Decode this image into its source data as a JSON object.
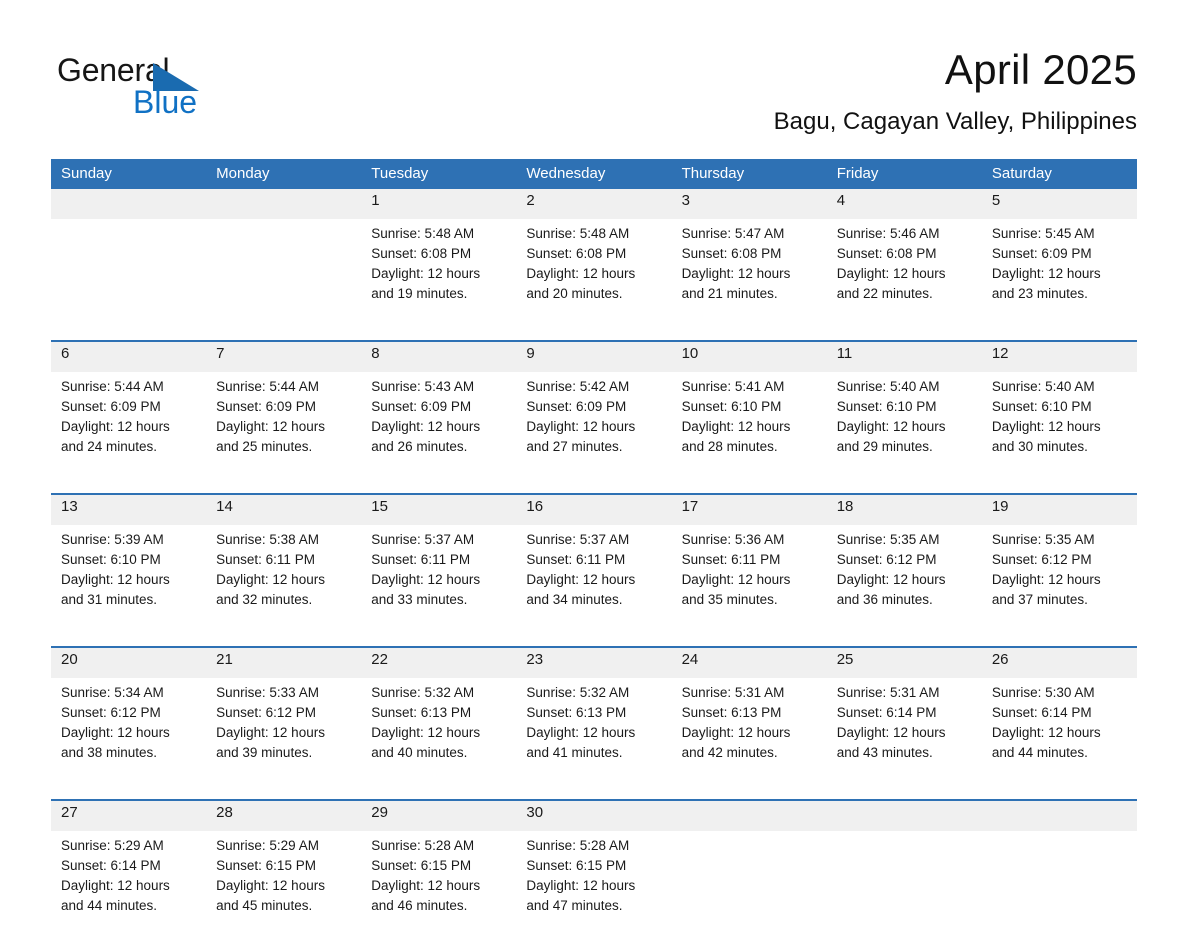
{
  "logo": {
    "word_one": "General",
    "word_two": "Blue",
    "triangle_color": "#1a6bb0",
    "blue_color": "#1071c4"
  },
  "header": {
    "title": "April 2025",
    "subtitle": "Bagu, Cagayan Valley, Philippines"
  },
  "theme": {
    "header_blue": "#2e71b4",
    "row_rule_blue": "#2e71b4",
    "daynum_band": "#f0f0f0",
    "page_background": "#ffffff",
    "text": "#1a1a1a"
  },
  "calendar": {
    "day_headers": [
      "Sunday",
      "Monday",
      "Tuesday",
      "Wednesday",
      "Thursday",
      "Friday",
      "Saturday"
    ],
    "weeks": [
      [
        {
          "day": "",
          "lines": []
        },
        {
          "day": "",
          "lines": []
        },
        {
          "day": "1",
          "lines": [
            "Sunrise: 5:48 AM",
            "Sunset: 6:08 PM",
            "Daylight: 12 hours",
            "and 19 minutes."
          ]
        },
        {
          "day": "2",
          "lines": [
            "Sunrise: 5:48 AM",
            "Sunset: 6:08 PM",
            "Daylight: 12 hours",
            "and 20 minutes."
          ]
        },
        {
          "day": "3",
          "lines": [
            "Sunrise: 5:47 AM",
            "Sunset: 6:08 PM",
            "Daylight: 12 hours",
            "and 21 minutes."
          ]
        },
        {
          "day": "4",
          "lines": [
            "Sunrise: 5:46 AM",
            "Sunset: 6:08 PM",
            "Daylight: 12 hours",
            "and 22 minutes."
          ]
        },
        {
          "day": "5",
          "lines": [
            "Sunrise: 5:45 AM",
            "Sunset: 6:09 PM",
            "Daylight: 12 hours",
            "and 23 minutes."
          ]
        }
      ],
      [
        {
          "day": "6",
          "lines": [
            "Sunrise: 5:44 AM",
            "Sunset: 6:09 PM",
            "Daylight: 12 hours",
            "and 24 minutes."
          ]
        },
        {
          "day": "7",
          "lines": [
            "Sunrise: 5:44 AM",
            "Sunset: 6:09 PM",
            "Daylight: 12 hours",
            "and 25 minutes."
          ]
        },
        {
          "day": "8",
          "lines": [
            "Sunrise: 5:43 AM",
            "Sunset: 6:09 PM",
            "Daylight: 12 hours",
            "and 26 minutes."
          ]
        },
        {
          "day": "9",
          "lines": [
            "Sunrise: 5:42 AM",
            "Sunset: 6:09 PM",
            "Daylight: 12 hours",
            "and 27 minutes."
          ]
        },
        {
          "day": "10",
          "lines": [
            "Sunrise: 5:41 AM",
            "Sunset: 6:10 PM",
            "Daylight: 12 hours",
            "and 28 minutes."
          ]
        },
        {
          "day": "11",
          "lines": [
            "Sunrise: 5:40 AM",
            "Sunset: 6:10 PM",
            "Daylight: 12 hours",
            "and 29 minutes."
          ]
        },
        {
          "day": "12",
          "lines": [
            "Sunrise: 5:40 AM",
            "Sunset: 6:10 PM",
            "Daylight: 12 hours",
            "and 30 minutes."
          ]
        }
      ],
      [
        {
          "day": "13",
          "lines": [
            "Sunrise: 5:39 AM",
            "Sunset: 6:10 PM",
            "Daylight: 12 hours",
            "and 31 minutes."
          ]
        },
        {
          "day": "14",
          "lines": [
            "Sunrise: 5:38 AM",
            "Sunset: 6:11 PM",
            "Daylight: 12 hours",
            "and 32 minutes."
          ]
        },
        {
          "day": "15",
          "lines": [
            "Sunrise: 5:37 AM",
            "Sunset: 6:11 PM",
            "Daylight: 12 hours",
            "and 33 minutes."
          ]
        },
        {
          "day": "16",
          "lines": [
            "Sunrise: 5:37 AM",
            "Sunset: 6:11 PM",
            "Daylight: 12 hours",
            "and 34 minutes."
          ]
        },
        {
          "day": "17",
          "lines": [
            "Sunrise: 5:36 AM",
            "Sunset: 6:11 PM",
            "Daylight: 12 hours",
            "and 35 minutes."
          ]
        },
        {
          "day": "18",
          "lines": [
            "Sunrise: 5:35 AM",
            "Sunset: 6:12 PM",
            "Daylight: 12 hours",
            "and 36 minutes."
          ]
        },
        {
          "day": "19",
          "lines": [
            "Sunrise: 5:35 AM",
            "Sunset: 6:12 PM",
            "Daylight: 12 hours",
            "and 37 minutes."
          ]
        }
      ],
      [
        {
          "day": "20",
          "lines": [
            "Sunrise: 5:34 AM",
            "Sunset: 6:12 PM",
            "Daylight: 12 hours",
            "and 38 minutes."
          ]
        },
        {
          "day": "21",
          "lines": [
            "Sunrise: 5:33 AM",
            "Sunset: 6:12 PM",
            "Daylight: 12 hours",
            "and 39 minutes."
          ]
        },
        {
          "day": "22",
          "lines": [
            "Sunrise: 5:32 AM",
            "Sunset: 6:13 PM",
            "Daylight: 12 hours",
            "and 40 minutes."
          ]
        },
        {
          "day": "23",
          "lines": [
            "Sunrise: 5:32 AM",
            "Sunset: 6:13 PM",
            "Daylight: 12 hours",
            "and 41 minutes."
          ]
        },
        {
          "day": "24",
          "lines": [
            "Sunrise: 5:31 AM",
            "Sunset: 6:13 PM",
            "Daylight: 12 hours",
            "and 42 minutes."
          ]
        },
        {
          "day": "25",
          "lines": [
            "Sunrise: 5:31 AM",
            "Sunset: 6:14 PM",
            "Daylight: 12 hours",
            "and 43 minutes."
          ]
        },
        {
          "day": "26",
          "lines": [
            "Sunrise: 5:30 AM",
            "Sunset: 6:14 PM",
            "Daylight: 12 hours",
            "and 44 minutes."
          ]
        }
      ],
      [
        {
          "day": "27",
          "lines": [
            "Sunrise: 5:29 AM",
            "Sunset: 6:14 PM",
            "Daylight: 12 hours",
            "and 44 minutes."
          ]
        },
        {
          "day": "28",
          "lines": [
            "Sunrise: 5:29 AM",
            "Sunset: 6:15 PM",
            "Daylight: 12 hours",
            "and 45 minutes."
          ]
        },
        {
          "day": "29",
          "lines": [
            "Sunrise: 5:28 AM",
            "Sunset: 6:15 PM",
            "Daylight: 12 hours",
            "and 46 minutes."
          ]
        },
        {
          "day": "30",
          "lines": [
            "Sunrise: 5:28 AM",
            "Sunset: 6:15 PM",
            "Daylight: 12 hours",
            "and 47 minutes."
          ]
        },
        {
          "day": "",
          "lines": []
        },
        {
          "day": "",
          "lines": []
        },
        {
          "day": "",
          "lines": []
        }
      ]
    ]
  }
}
